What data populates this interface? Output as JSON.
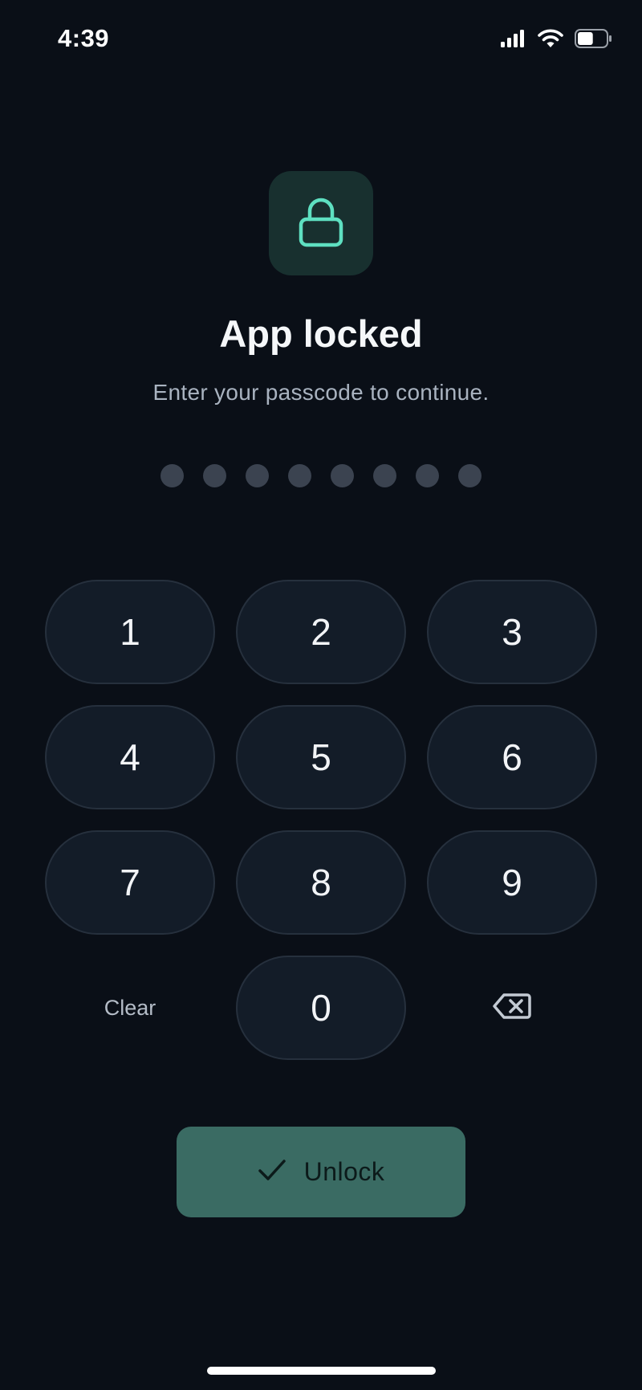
{
  "status_bar": {
    "time": "4:39",
    "icons": [
      "signal-icon",
      "wifi-icon",
      "battery-icon"
    ],
    "battery_fraction": 0.55
  },
  "lock_screen": {
    "icon": "lock-icon",
    "title": "App locked",
    "subtitle": "Enter your passcode to continue.",
    "passcode_length": 8,
    "entered_digits": 0
  },
  "keypad": {
    "keys": [
      "1",
      "2",
      "3",
      "4",
      "5",
      "6",
      "7",
      "8",
      "9"
    ],
    "clear_label": "Clear",
    "zero": "0",
    "backspace_icon": "backspace-icon"
  },
  "unlock_button": {
    "label": "Unlock",
    "icon": "checkmark-icon"
  },
  "colors": {
    "background": "#0a0f17",
    "accent": "#5ee0c1",
    "tile": "#18302f",
    "key_fill": "#131c28",
    "key_border": "#26303d",
    "dot_empty": "#3b4350",
    "unlock_fill": "#3a6b63"
  }
}
